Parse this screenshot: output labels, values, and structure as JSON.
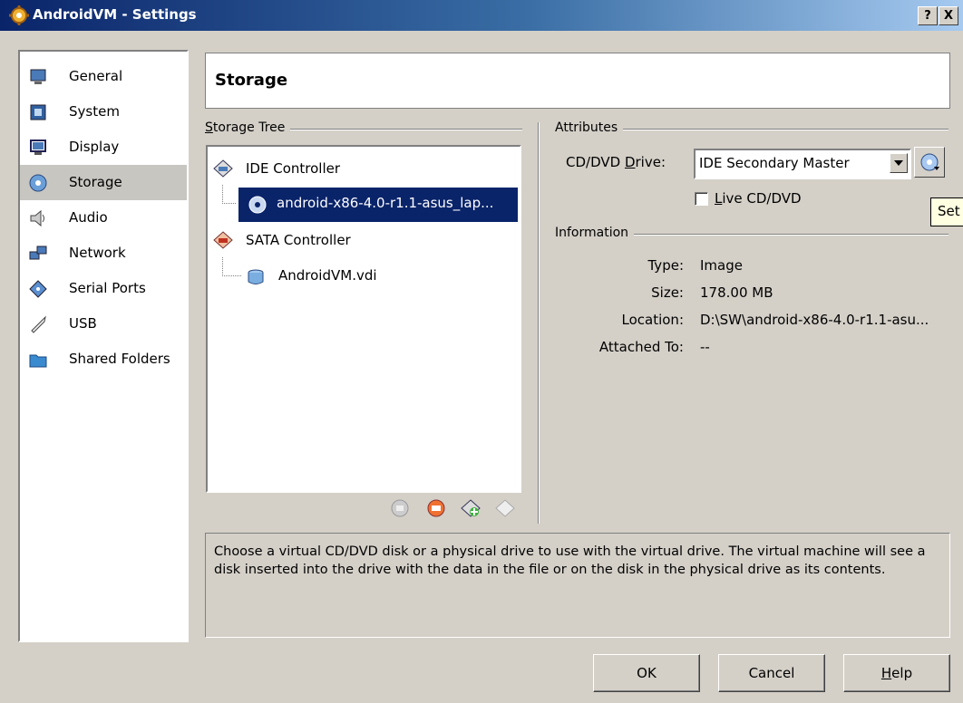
{
  "window": {
    "title": "AndroidVM - Settings",
    "help_btn": "?",
    "close_btn": "X"
  },
  "sidebar": {
    "items": [
      {
        "label": "General",
        "icon": "monitor-icon"
      },
      {
        "label": "System",
        "icon": "chip-icon"
      },
      {
        "label": "Display",
        "icon": "display-icon"
      },
      {
        "label": "Storage",
        "icon": "disk-icon"
      },
      {
        "label": "Audio",
        "icon": "speaker-icon"
      },
      {
        "label": "Network",
        "icon": "network-icon"
      },
      {
        "label": "Serial Ports",
        "icon": "serial-port-icon"
      },
      {
        "label": "USB",
        "icon": "usb-icon"
      },
      {
        "label": "Shared Folders",
        "icon": "folder-icon"
      }
    ],
    "selected": "Storage"
  },
  "header": {
    "title": "Storage"
  },
  "storage_tree": {
    "label_prefix": "S",
    "label_rest": "torage Tree",
    "nodes": [
      {
        "label": "IDE Controller"
      },
      {
        "label": "android-x86-4.0-r1.1-asus_lap..."
      },
      {
        "label": "SATA Controller"
      },
      {
        "label": "AndroidVM.vdi"
      }
    ]
  },
  "attributes": {
    "group_label": "Attributes",
    "drive_label_pre": "CD/DVD ",
    "drive_label_u": "D",
    "drive_label_post": "rive:",
    "drive_value": "IDE Secondary Master",
    "live_u": "L",
    "live_rest": "ive CD/DVD",
    "tooltip": "Set"
  },
  "information": {
    "group_label": "Information",
    "rows": [
      {
        "label": "Type:",
        "value": "Image"
      },
      {
        "label": "Size:",
        "value": "178.00 MB"
      },
      {
        "label": "Location:",
        "value": "D:\\SW\\android-x86-4.0-r1.1-asu..."
      },
      {
        "label": "Attached To:",
        "value": "--"
      }
    ]
  },
  "description": "Choose a virtual CD/DVD disk or a physical drive to use with the virtual drive. The virtual machine will see a disk inserted into the drive with the data in the file or on the disk in the physical drive as its contents.",
  "buttons": {
    "ok": "OK",
    "cancel": "Cancel",
    "help_u": "H",
    "help_rest": "elp"
  }
}
